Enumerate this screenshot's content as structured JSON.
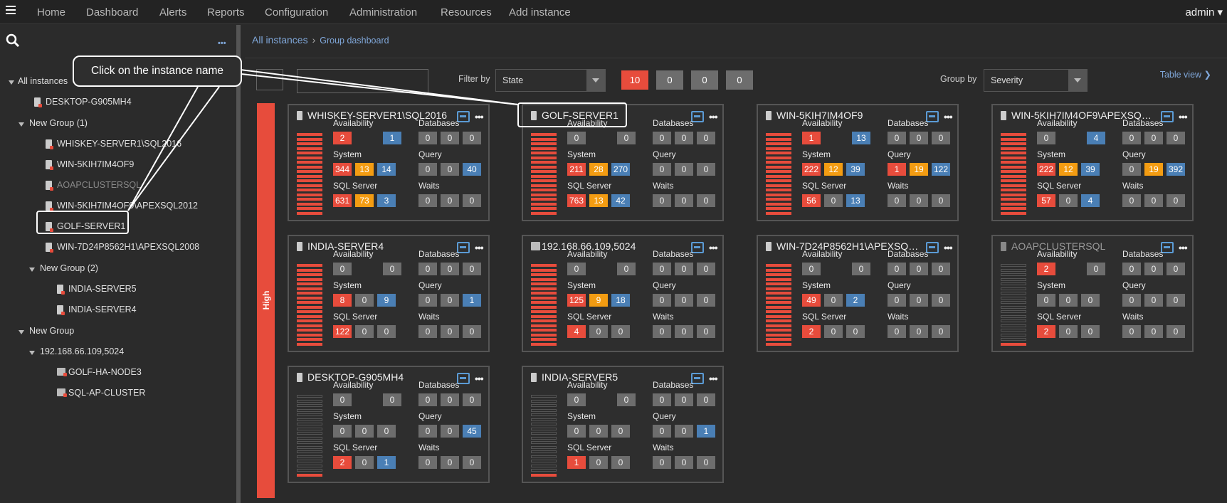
{
  "topnav": {
    "items": [
      "Home",
      "Dashboard",
      "Alerts",
      "Reports",
      "Configuration",
      "Administration",
      "Resources",
      "Add instance"
    ],
    "user": "admin ▾"
  },
  "sidebar": {
    "dots": "•••",
    "tree": [
      {
        "label": "All instances",
        "type": "group"
      },
      {
        "label": "DESKTOP-G905MH4",
        "type": "server"
      },
      {
        "label": "New Group (1)",
        "type": "group"
      },
      {
        "label": "WHISKEY-SERVER1\\SQL2016",
        "type": "server"
      },
      {
        "label": "WIN-5KIH7IM4OF9",
        "type": "server"
      },
      {
        "label": "AOAPCLUSTERSQL",
        "type": "server",
        "dim": true
      },
      {
        "label": "WIN-5KIH7IM4OF9\\APEXSQL2012",
        "type": "server"
      },
      {
        "label": "GOLF-SERVER1",
        "type": "server"
      },
      {
        "label": "WIN-7D24P8562H1\\APEXSQL2008",
        "type": "server"
      },
      {
        "label": "New Group (2)",
        "type": "group"
      },
      {
        "label": "INDIA-SERVER5",
        "type": "server"
      },
      {
        "label": "INDIA-SERVER4",
        "type": "server"
      },
      {
        "label": "New Group",
        "type": "group"
      },
      {
        "label": "192.168.66.109,5024",
        "type": "group"
      },
      {
        "label": "GOLF-HA-NODE3",
        "type": "server"
      },
      {
        "label": "SQL-AP-CLUSTER",
        "type": "server"
      }
    ]
  },
  "breadcrumb": {
    "root": "All instances",
    "current": "Group dashboard"
  },
  "toolbar": {
    "filter_label": "Filter by",
    "filter_value": "State",
    "counts": [
      "10",
      "0",
      "0",
      "0"
    ],
    "group_label": "Group by",
    "group_value": "Severity",
    "table_view": "Table view ❯"
  },
  "severity_label": "High",
  "callout": "Click on the instance name",
  "colors": {
    "critical": "#e74c3c",
    "warning": "#f39c12",
    "info": "#4a7fb5",
    "neutral": "#6d6d6d"
  },
  "labels": {
    "availability": "Availability",
    "databases": "Databases",
    "system": "System",
    "query": "Query",
    "sqlserver": "SQL Server",
    "waits": "Waits"
  },
  "cards": [
    {
      "title": "WHISKEY-SERVER1\\SQL2016",
      "level": 1.0,
      "availability": [
        "2",
        "1"
      ],
      "databases": [
        "0",
        "0",
        "0"
      ],
      "system": [
        "344",
        "13",
        "14"
      ],
      "query": [
        "0",
        "0",
        "40"
      ],
      "sqlserver": [
        "631",
        "73",
        "3"
      ],
      "waits": [
        "0",
        "0",
        "0"
      ]
    },
    {
      "title": "GOLF-SERVER1",
      "level": 1.0,
      "availability": [
        "0",
        "0"
      ],
      "databases": [
        "0",
        "0",
        "0"
      ],
      "system": [
        "211",
        "28",
        "270"
      ],
      "query": [
        "0",
        "0",
        "0"
      ],
      "sqlserver": [
        "763",
        "13",
        "42"
      ],
      "waits": [
        "0",
        "0",
        "0"
      ]
    },
    {
      "title": "WIN-5KIH7IM4OF9",
      "level": 1.0,
      "availability": [
        "1",
        "13"
      ],
      "databases": [
        "0",
        "0",
        "0"
      ],
      "system": [
        "222",
        "12",
        "39"
      ],
      "query": [
        "1",
        "19",
        "122"
      ],
      "sqlserver": [
        "56",
        "0",
        "13"
      ],
      "waits": [
        "0",
        "0",
        "0"
      ]
    },
    {
      "title": "WIN-5KIH7IM4OF9\\APEXSQL2...",
      "level": 1.0,
      "availability": [
        "0",
        "4"
      ],
      "databases": [
        "0",
        "0",
        "0"
      ],
      "system": [
        "222",
        "12",
        "39"
      ],
      "query": [
        "0",
        "19",
        "392"
      ],
      "sqlserver": [
        "57",
        "0",
        "4"
      ],
      "waits": [
        "0",
        "0",
        "0"
      ]
    },
    {
      "title": "INDIA-SERVER4",
      "level": 1.0,
      "availability": [
        "0",
        "0"
      ],
      "databases": [
        "0",
        "0",
        "0"
      ],
      "system": [
        "8",
        "0",
        "9"
      ],
      "query": [
        "0",
        "0",
        "1"
      ],
      "sqlserver": [
        "122",
        "0",
        "0"
      ],
      "waits": [
        "0",
        "0",
        "0"
      ]
    },
    {
      "title": "192.168.66.109,5024",
      "level": 1.0,
      "availability": [
        "0",
        "0"
      ],
      "databases": [
        "0",
        "0",
        "0"
      ],
      "system": [
        "125",
        "9",
        "18"
      ],
      "query": [
        "0",
        "0",
        "0"
      ],
      "sqlserver": [
        "4",
        "0",
        "0"
      ],
      "waits": [
        "0",
        "0",
        "0"
      ]
    },
    {
      "title": "WIN-7D24P8562H1\\APEXSQL...",
      "level": 1.0,
      "availability": [
        "0",
        "0"
      ],
      "databases": [
        "0",
        "0",
        "0"
      ],
      "system": [
        "49",
        "0",
        "2"
      ],
      "query": [
        "0",
        "0",
        "0"
      ],
      "sqlserver": [
        "2",
        "0",
        "0"
      ],
      "waits": [
        "0",
        "0",
        "0"
      ]
    },
    {
      "title": "AOAPCLUSTERSQL",
      "level": 0.07,
      "availability": [
        "2",
        "0"
      ],
      "databases": [
        "0",
        "0",
        "0"
      ],
      "system": [
        "0",
        "0",
        "0"
      ],
      "query": [
        "0",
        "0",
        "0"
      ],
      "sqlserver": [
        "2",
        "0",
        "0"
      ],
      "waits": [
        "0",
        "0",
        "0"
      ]
    },
    {
      "title": "DESKTOP-G905MH4",
      "level": 0.07,
      "availability": [
        "0",
        "0"
      ],
      "databases": [
        "0",
        "0",
        "0"
      ],
      "system": [
        "0",
        "0",
        "0"
      ],
      "query": [
        "0",
        "0",
        "45"
      ],
      "sqlserver": [
        "2",
        "0",
        "1"
      ],
      "waits": [
        "0",
        "0",
        "0"
      ]
    },
    {
      "title": "INDIA-SERVER5",
      "level": 0.07,
      "availability": [
        "0",
        "0"
      ],
      "databases": [
        "0",
        "0",
        "0"
      ],
      "system": [
        "0",
        "0",
        "0"
      ],
      "query": [
        "0",
        "0",
        "1"
      ],
      "sqlserver": [
        "1",
        "0",
        "0"
      ],
      "waits": [
        "0",
        "0",
        "0"
      ]
    }
  ]
}
